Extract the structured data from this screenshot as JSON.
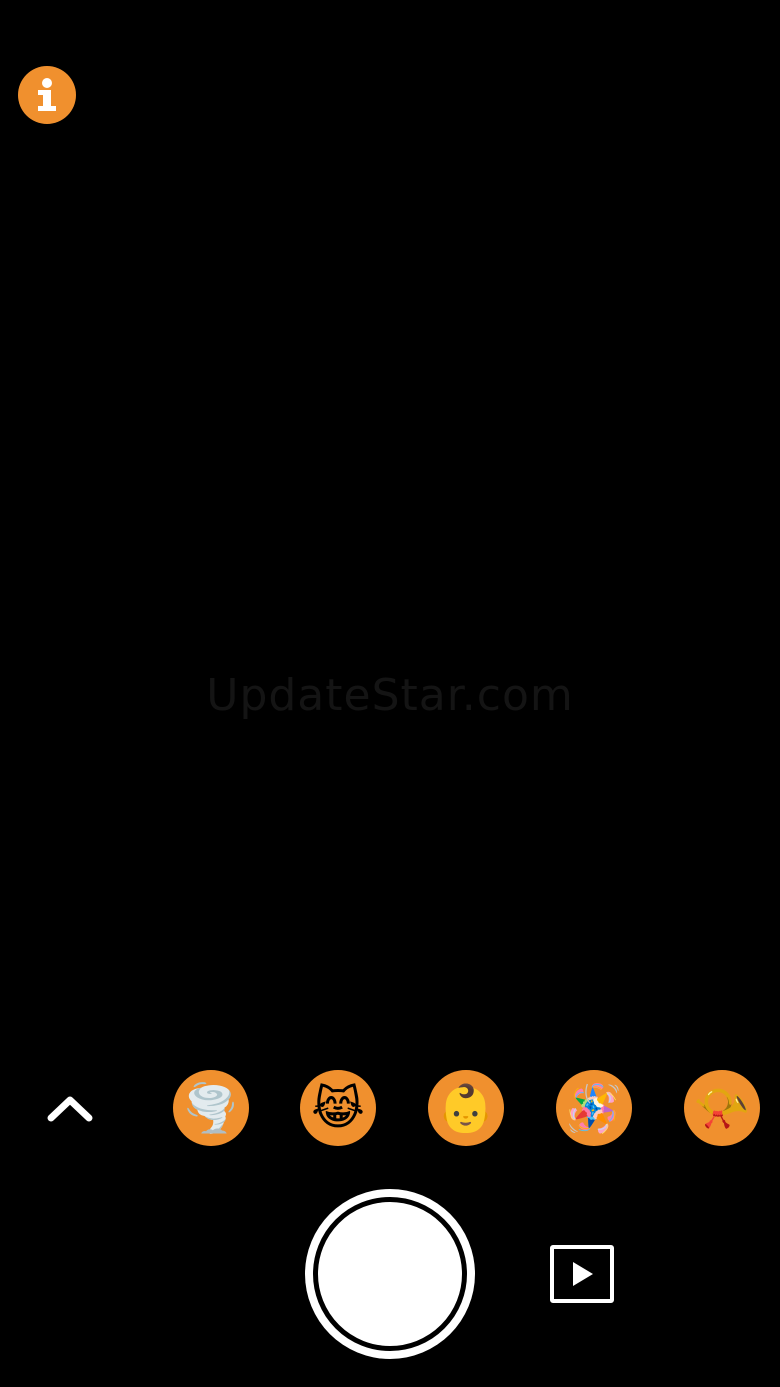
{
  "watermark": {
    "text": "UpdateStar.com"
  },
  "colors": {
    "accent": "#F0902E",
    "background": "#000000",
    "foreground": "#FFFFFF"
  },
  "info_button": {
    "icon": "info-icon"
  },
  "effects": [
    {
      "icon": "tornado-icon",
      "glyph": "🌪️"
    },
    {
      "icon": "cat-tears-of-joy-icon",
      "glyph": "😹"
    },
    {
      "icon": "baby-icon",
      "glyph": "👶"
    },
    {
      "icon": "party-horn-icon",
      "glyph": "🪅"
    },
    {
      "icon": "air-horn-icon",
      "glyph": "📯"
    }
  ],
  "controls": {
    "expand_icon": "chevron-up-icon",
    "shutter_icon": "shutter-button",
    "gallery_icon": "play-icon"
  }
}
